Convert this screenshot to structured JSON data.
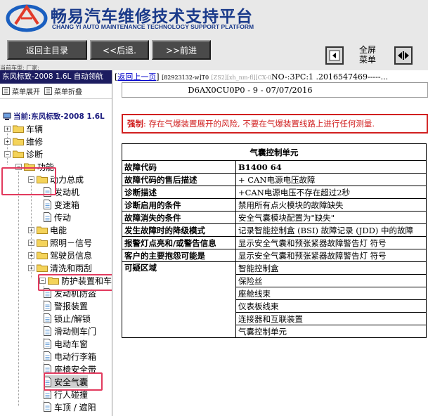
{
  "header": {
    "title": "畅易汽车维修技术支持平台",
    "subtitle": "CHANG YI AUTO MAINTENANCE TECHNOLOGY SUPPORT PLATFORM",
    "buttons": {
      "home": "返回主目录",
      "back": "<<后退.",
      "forward": ">>前进"
    },
    "fullscreen_menu": "全屏\n菜单",
    "vehicle_type_line": "当前车型:  厂家:"
  },
  "sidebar": {
    "vehicle": "东风标致-2008 1.6L 自动领航",
    "expand_menu": "菜单展开",
    "collapse_menu": "菜单折叠",
    "current": "当前:东风标致-2008 1.6L",
    "tree": [
      {
        "id": "n1",
        "label": "车辆",
        "type": "folder",
        "pm": "+"
      },
      {
        "id": "n2",
        "label": "维修",
        "type": "folder",
        "pm": "+"
      },
      {
        "id": "n3",
        "label": "诊断",
        "type": "folder",
        "pm": "−"
      },
      {
        "id": "n4",
        "label": "功能",
        "type": "folder",
        "pm": "−"
      },
      {
        "id": "n5",
        "label": "动力总成",
        "type": "folder",
        "pm": "−"
      },
      {
        "id": "n6",
        "label": "发动机",
        "type": "doc"
      },
      {
        "id": "n7",
        "label": "变速箱",
        "type": "doc"
      },
      {
        "id": "n8",
        "label": "传动",
        "type": "doc"
      },
      {
        "id": "n9",
        "label": "电能",
        "type": "folder",
        "pm": "+"
      },
      {
        "id": "n10",
        "label": "照明－信号",
        "type": "folder",
        "pm": "+"
      },
      {
        "id": "n11",
        "label": "驾驶员信息",
        "type": "folder",
        "pm": "+"
      },
      {
        "id": "n12",
        "label": "清洗和雨刮",
        "type": "folder",
        "pm": "+"
      },
      {
        "id": "n13",
        "label": "防护装置和车门",
        "type": "folder",
        "pm": "−"
      },
      {
        "id": "n14",
        "label": "发动机防盗",
        "type": "doc"
      },
      {
        "id": "n15",
        "label": "警报装置",
        "type": "doc"
      },
      {
        "id": "n16",
        "label": "锁止/解锁",
        "type": "doc"
      },
      {
        "id": "n17",
        "label": "滑动侧车门",
        "type": "doc"
      },
      {
        "id": "n18",
        "label": "电动车窗",
        "type": "doc"
      },
      {
        "id": "n19",
        "label": "电动行李箱",
        "type": "doc"
      },
      {
        "id": "n20",
        "label": "座椅安全带",
        "type": "doc"
      },
      {
        "id": "n21",
        "label": "安全气囊",
        "type": "doc",
        "selected": true
      },
      {
        "id": "n22",
        "label": "行人碰撞",
        "type": "doc"
      },
      {
        "id": "n23",
        "label": "车顶 / 遮阳",
        "type": "doc"
      }
    ]
  },
  "main": {
    "back_link": "返回上一页",
    "top_code": "[82923132-w]T0",
    "top_gray": "[ZS2][xh_nm-fl][CX-0",
    "top_tail": "NO-:3PC:1 .2016547469-----...",
    "doc_id": "D6AX0CU0P0 - 9 - 07/07/2016",
    "warning": {
      "strong": "强制",
      "text": ": 存在",
      "red_text": "气爆装置展开的风险",
      "rest": ", 不要在气爆装置线路上进行任何测量."
    },
    "table": {
      "caption": "气囊控制单元",
      "rows": [
        {
          "label": "故障代码",
          "value": "B1400 64",
          "value_bold": true
        },
        {
          "label": "故障代码的售后描述",
          "value": "+ CAN电源电压故障"
        },
        {
          "label": "诊断描述",
          "value": "+CAN电源电压不存在超过2秒"
        },
        {
          "label": "诊断启用的条件",
          "value": "禁用所有点火模块的故障缺失"
        },
        {
          "label": "故障消失的条件",
          "value": "安全气囊模块配置为\"缺失\""
        },
        {
          "label": "发生故障时的降级模式",
          "value": "记录智能控制盒 (BSI) 故障记录 (JDD) 中的故障"
        },
        {
          "label": "报警灯点亮和/或警告信息",
          "value": "显示安全气囊和预张紧器故障警告灯 符号"
        },
        {
          "label": "客户的主要抱怨可能是",
          "value": "显示安全气囊和预张紧器故障警告灯 符号"
        }
      ],
      "suspect_label": "可疑区域",
      "suspects": [
        "智能控制盒",
        "保险丝",
        "座舱线束",
        "仪表板线束",
        "连接器和互联装置",
        "气囊控制单元"
      ]
    }
  },
  "colors": {
    "title_blue": "#1a3a8a",
    "vehicle_bar": "#1c1c60",
    "warning_red": "#d12020",
    "highlight_box": "#e23a5e"
  }
}
